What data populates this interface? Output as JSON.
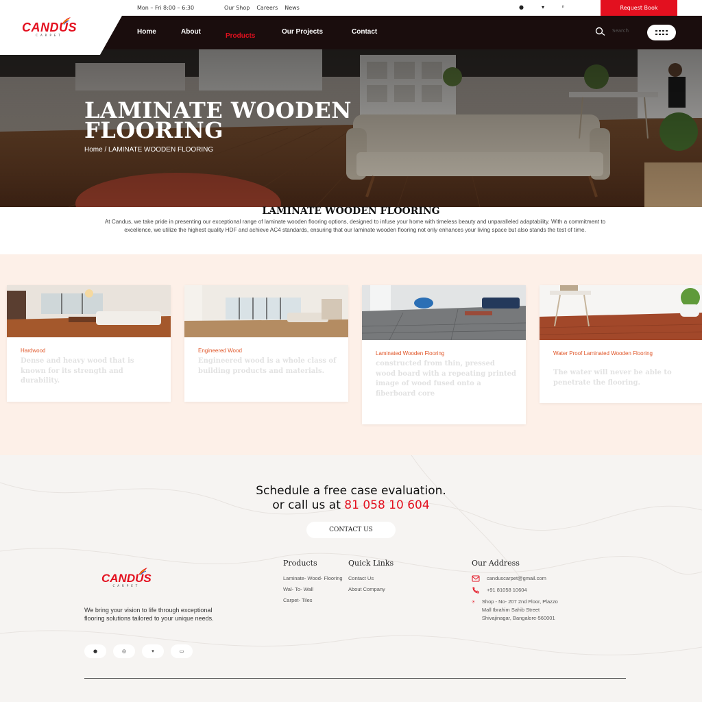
{
  "topbar": {
    "hours": "Mon – Fri 8:00 – 6:30",
    "links": [
      "Our Shop",
      "Careers",
      "News"
    ],
    "social_icons": [
      "facebook-icon",
      "twitter-icon",
      "pinterest-icon"
    ],
    "request_button": "Request Book"
  },
  "brand": {
    "name": "CANDUS",
    "tagline": "CARPET"
  },
  "nav": {
    "items": [
      "Home",
      "About",
      "Products",
      "Our Projects",
      "Contact"
    ],
    "active": "Products",
    "search_placeholder": "Search"
  },
  "hero": {
    "title_line1": "LAMINATE WOODEN",
    "title_line2": "FLOORING",
    "breadcrumb": "Home / LAMINATE WOODEN FLOORING"
  },
  "intro": {
    "title": "LAMINATE WOODEN FLOORING",
    "text": "At Candus, we take pride in presenting our exceptional range of laminate wooden flooring options, designed to infuse your home with timeless beauty and unparalleled adaptability. With a commitment to excellence, we utilize the highest  quality HDF and achieve AC4 standards, ensuring that our laminate wooden flooring not only enhances your living space but also stands the test of time."
  },
  "cards": [
    {
      "title": "Hardwood",
      "desc": "Dense and heavy wood that is known for its strength and durability."
    },
    {
      "title": "Engineered Wood",
      "desc": "Engineered wood is a whole class of building products and materials."
    },
    {
      "title": "Laminated Wooden Flooring",
      "desc": "constructed from thin, pressed wood board with a repeating printed image of wood fused onto a fiberboard core"
    },
    {
      "title": "Water Proof Laminated Wooden Flooring",
      "desc": "The water will never be able to penetrate the flooring."
    }
  ],
  "cta": {
    "line1": "Schedule a free case evaluation.",
    "line2_prefix": "or call us at ",
    "phone": "81 058 10 604",
    "button": "CONTACT US"
  },
  "footer": {
    "tagline": "We bring your vision to life through exceptional flooring solutions tailored to your unique needs.",
    "social_icons": [
      "facebook-icon",
      "instagram-icon",
      "twitter-icon",
      "linkedin-icon"
    ],
    "products_title": "Products",
    "products": [
      "Laminate- Wood- Flooring",
      "Wal- To- Wall",
      "Carpet- Tiles"
    ],
    "quick_title": "Quick Links",
    "quick": [
      "Contact Us",
      "About Company"
    ],
    "address_title": "Our Address",
    "email": "canduscarpet@gmail.com",
    "phone": "+91 81058 10604",
    "address": "Shop - No- 207 2nd Floor, Plazzo Mall Ibrahim Sahib Street Shivajinagar, Bangalore-560001"
  },
  "colors": {
    "accent": "#e3101f",
    "nav_bg": "#1a0d0d",
    "card_title": "#e0572a",
    "cards_bg": "#fdf0e8"
  }
}
